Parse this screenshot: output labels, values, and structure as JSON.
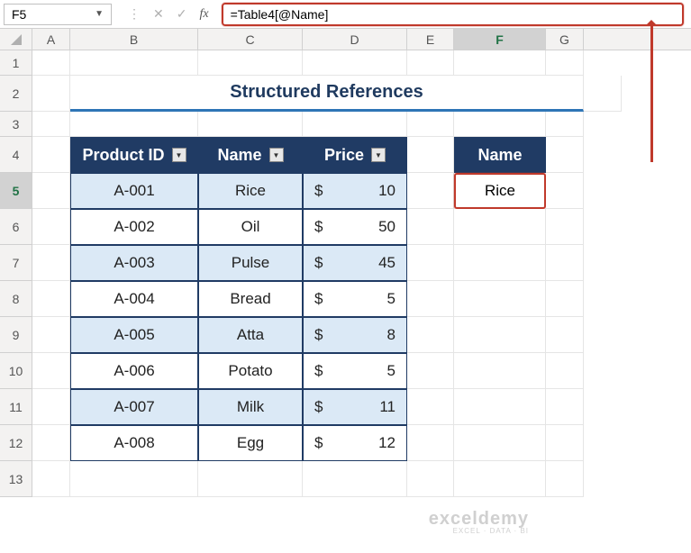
{
  "nameBox": "F5",
  "formula": "=Table4[@Name]",
  "columns": [
    "A",
    "B",
    "C",
    "D",
    "E",
    "F",
    "G"
  ],
  "title": "Structured References",
  "table": {
    "headers": {
      "pid": "Product ID",
      "name": "Name",
      "price": "Price"
    },
    "rows": [
      {
        "pid": "A-001",
        "name": "Rice",
        "price": "10"
      },
      {
        "pid": "A-002",
        "name": "Oil",
        "price": "50"
      },
      {
        "pid": "A-003",
        "name": "Pulse",
        "price": "45"
      },
      {
        "pid": "A-004",
        "name": "Bread",
        "price": "5"
      },
      {
        "pid": "A-005",
        "name": "Atta",
        "price": "8"
      },
      {
        "pid": "A-006",
        "name": "Potato",
        "price": "5"
      },
      {
        "pid": "A-007",
        "name": "Milk",
        "price": "11"
      },
      {
        "pid": "A-008",
        "name": "Egg",
        "price": "12"
      }
    ],
    "currency": "$"
  },
  "side": {
    "header": "Name",
    "value": "Rice"
  },
  "watermark": {
    "line1": "exceldemy",
    "line2": "EXCEL · DATA · BI"
  },
  "activeCell": {
    "col": "F",
    "row": 5
  }
}
